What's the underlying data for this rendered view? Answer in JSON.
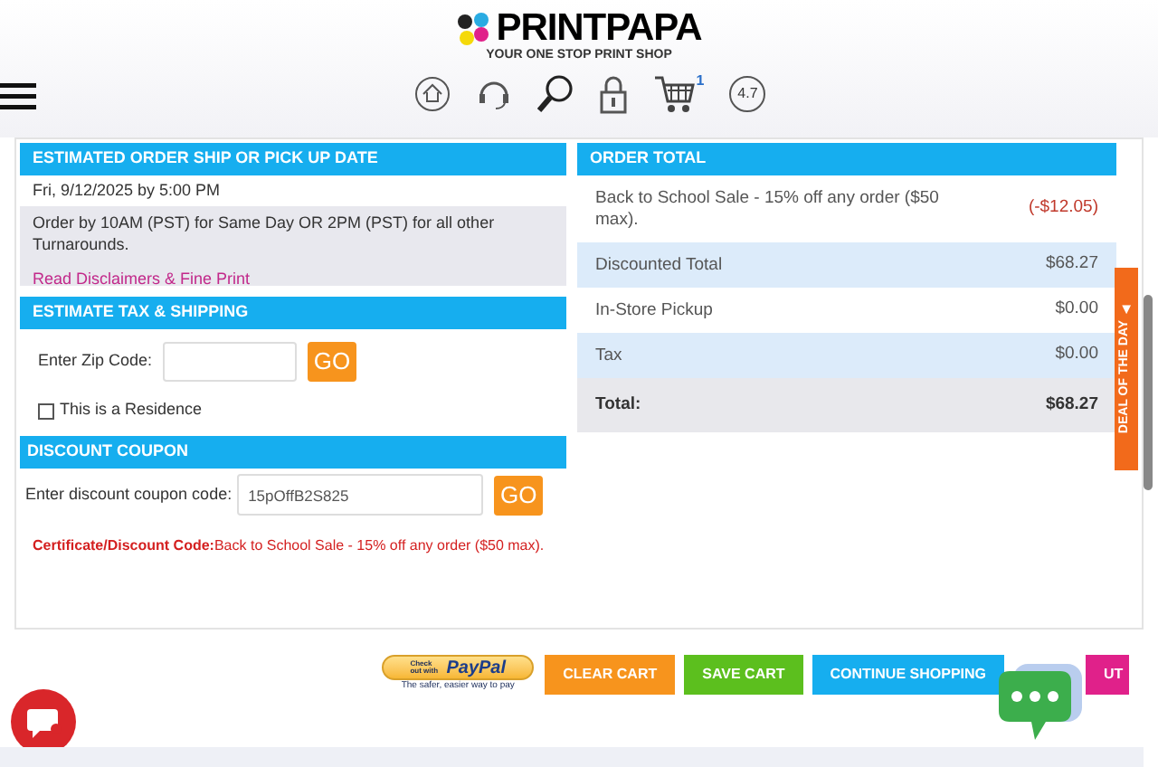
{
  "header": {
    "logo": "PRINTPAPA",
    "tagline": "YOUR ONE STOP PRINT SHOP",
    "cart_count": "1",
    "rating": "4.7"
  },
  "ship_date": {
    "title": "ESTIMATED ORDER SHIP OR PICK UP DATE",
    "date": "Fri, 9/12/2025 by 5:00 PM",
    "notice": "Order by 10AM (PST) for Same Day OR 2PM (PST) for all other Turnarounds.",
    "link": "Read Disclaimers & Fine Print"
  },
  "tax_shipping": {
    "title": "ESTIMATE TAX & SHIPPING",
    "zip_label": "Enter Zip Code:",
    "go": "GO",
    "residence_label": "This is a Residence",
    "residence_checked": false
  },
  "coupon": {
    "title": "DISCOUNT COUPON",
    "label": "Enter discount coupon code:",
    "value": "15pOffB2S825",
    "go": "GO",
    "message": "**Certificate/Discount Code:**Back to School Sale - 15% off any order ($50 max)."
  },
  "order_total": {
    "title": "ORDER TOTAL",
    "rows": [
      {
        "kind": "discount",
        "label": "Back to School Sale - 15% off any order ($50 max).",
        "value": "(-$12.05)"
      },
      {
        "kind": "shaded",
        "label": "Discounted Total",
        "value": "$68.27"
      },
      {
        "kind": "plain",
        "label": "In-Store Pickup",
        "value": "$0.00"
      },
      {
        "kind": "shaded",
        "label": "Tax",
        "value": "$0.00"
      },
      {
        "kind": "total",
        "label": "Total:",
        "value": "$68.27"
      }
    ]
  },
  "deal_tab": "DEAL OF THE DAY",
  "paypal": {
    "top": "Check out with",
    "brand": "PayPal",
    "slogan": "The safer, easier way to pay"
  },
  "buttons": [
    {
      "kind": "orange",
      "label": "CLEAR CART"
    },
    {
      "kind": "green",
      "label": "SAVE CART"
    },
    {
      "kind": "blue",
      "label": "CONTINUE SHOPPING"
    },
    {
      "kind": "pink",
      "label": "UT"
    }
  ]
}
